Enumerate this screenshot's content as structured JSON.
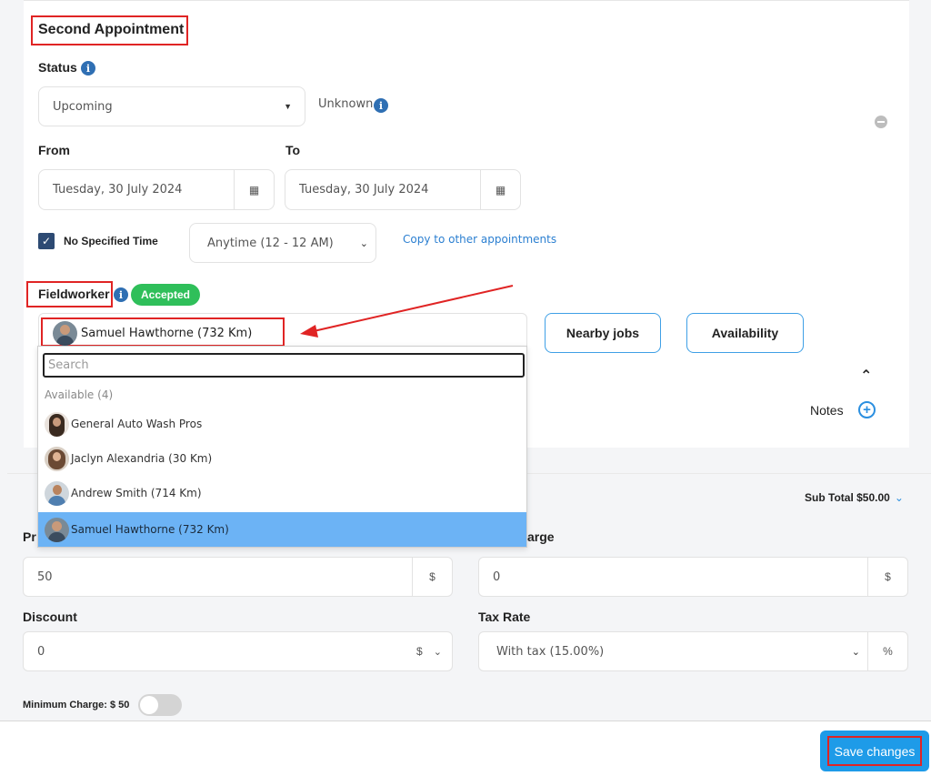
{
  "appointment": {
    "title": "Second Appointment",
    "status_label": "Status",
    "status_value": "Upcoming",
    "status_extra": "Unknown",
    "from_label": "From",
    "to_label": "To",
    "from_value": "Tuesday, 30 July 2024",
    "to_value": "Tuesday, 30 July 2024",
    "no_time_label": "No Specified Time",
    "no_time_checked": true,
    "time_select_value": "Anytime (12 - 12 AM)",
    "copy_link": "Copy to other appointments",
    "fieldworker_label": "Fieldworker",
    "fieldworker_badge": "Accepted",
    "fieldworker_value": "Samuel Hawthorne (732 Km)",
    "nearby_jobs": "Nearby jobs",
    "availability": "Availability",
    "notes_label": "Notes"
  },
  "dropdown": {
    "search_placeholder": "Search",
    "group_label": "Available (4)",
    "items": [
      {
        "label": "General Auto Wash Pros",
        "selected": false
      },
      {
        "label": "Jaclyn Alexandria (30 Km)",
        "selected": false
      },
      {
        "label": "Andrew Smith (714 Km)",
        "selected": false
      },
      {
        "label": "Samuel Hawthorne (732 Km)",
        "selected": true
      }
    ]
  },
  "pricing": {
    "subtotal": "Sub Total $50.00",
    "price_label_partial": "Pr",
    "charge_label_partial": "arge",
    "price_value": "50",
    "price_addon": "$",
    "charge_value": "0",
    "charge_addon": "$",
    "discount_label": "Discount",
    "discount_value": "0",
    "discount_addon": "$",
    "tax_label": "Tax Rate",
    "tax_value": "With tax (15.00%)",
    "tax_addon": "%",
    "min_charge_label": "Minimum Charge: $ 50",
    "min_charge_enabled": false
  },
  "footer": {
    "save_label": "Save changes"
  },
  "colors": {
    "accent": "#1e9be8",
    "badge_green": "#2fbf5a",
    "highlight_red": "#e02424",
    "selected_row": "#6cb3f5"
  }
}
